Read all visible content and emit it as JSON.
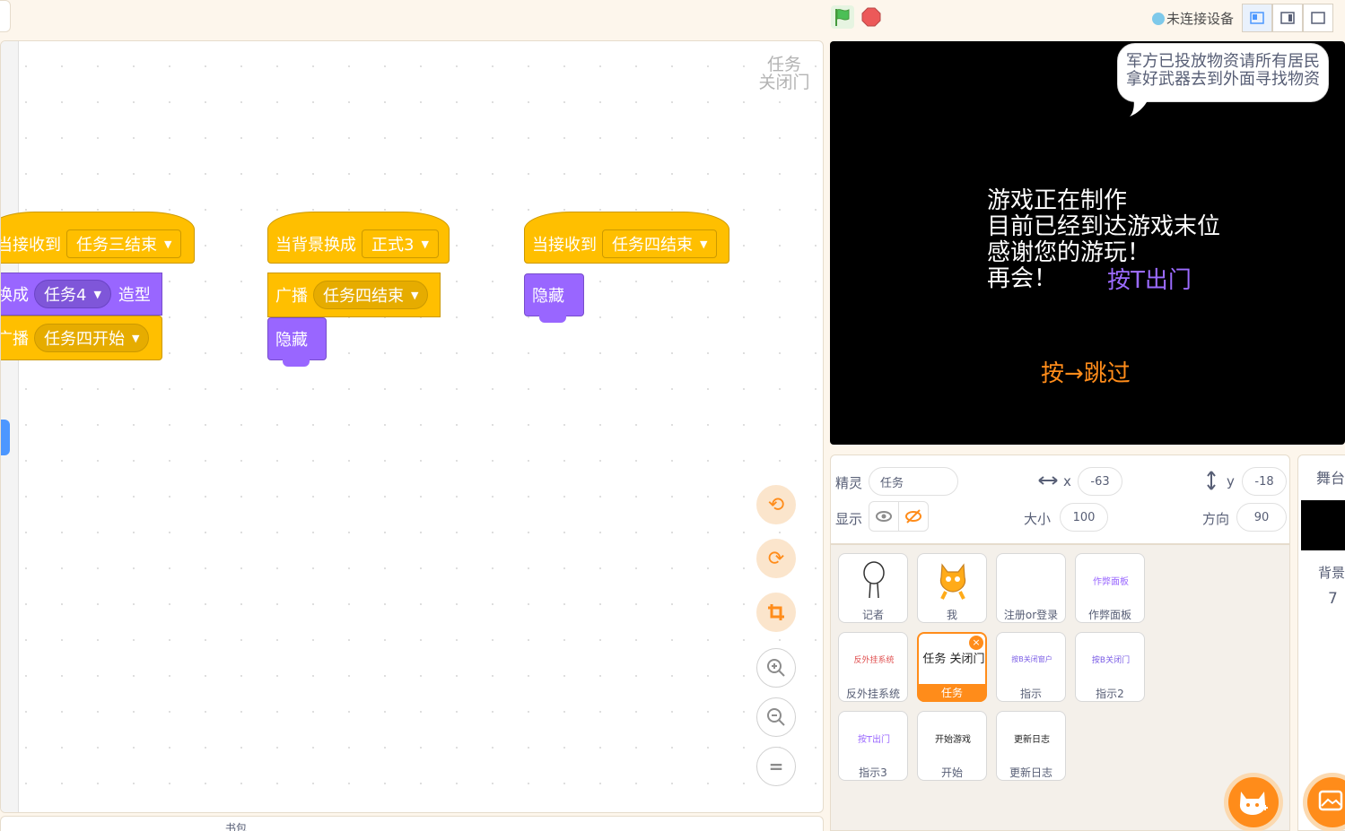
{
  "topbar": {
    "connection_status": "未连接设备",
    "layout_modes": [
      "small-stage",
      "normal-stage",
      "fullscreen"
    ]
  },
  "workspace": {
    "sprite_watermark_line1": "任务",
    "sprite_watermark_line2": "关闭门",
    "scripts": [
      {
        "hat_label": "当接收到",
        "hat_value": "任务三结束",
        "blocks": [
          {
            "label": "换成",
            "value": "任务4",
            "suffix": "造型"
          },
          {
            "label": "广播",
            "value": "任务四开始"
          }
        ]
      },
      {
        "hat_label": "当背景换成",
        "hat_value": "正式3",
        "blocks": [
          {
            "label": "广播",
            "value": "任务四结束"
          },
          {
            "label": "隐藏"
          }
        ]
      },
      {
        "hat_label": "当接收到",
        "hat_value": "任务四结束",
        "blocks": [
          {
            "label": "隐藏"
          }
        ]
      }
    ],
    "zoom_controls": [
      "undo-icon",
      "redo-icon",
      "crop-icon",
      "zoom-in-icon",
      "zoom-out-icon",
      "zoom-reset-icon"
    ],
    "backpack_label": "书包"
  },
  "stage": {
    "speech_line1": "军方已投放物资请所有居民",
    "speech_line2": "拿好武器去到外面寻找物资",
    "main_lines": [
      "游戏正在制作",
      "目前已经到达游戏末位",
      "感谢您的游玩！",
      "再会！"
    ],
    "exit_hint": "按T出门",
    "skip_hint": "按→跳过"
  },
  "sprite_info": {
    "sprite_label": "精灵",
    "sprite_name": "任务",
    "x_label": "x",
    "x_value": "-63",
    "y_label": "y",
    "y_value": "-18",
    "show_label": "显示",
    "size_label": "大小",
    "size_value": "100",
    "direction_label": "方向",
    "direction_value": "90"
  },
  "sprites": [
    {
      "name": "记者",
      "thumb": ""
    },
    {
      "name": "我",
      "thumb": ""
    },
    {
      "name": "注册or登录",
      "thumb": ""
    },
    {
      "name": "作弊面板",
      "thumb": "作弊面板"
    },
    {
      "name": "反外挂系统",
      "thumb": "反外挂系统"
    },
    {
      "name": "任务",
      "thumb": "任务 关闭门",
      "selected": true
    },
    {
      "name": "指示",
      "thumb": "按B关闭窗户"
    },
    {
      "name": "指示2",
      "thumb": "按B关闭门"
    },
    {
      "name": "指示3",
      "thumb": "按T出门"
    },
    {
      "name": "开始",
      "thumb": "开始游戏"
    },
    {
      "name": "更新日志",
      "thumb": "更新日志"
    }
  ],
  "stage_panel": {
    "title": "舞台",
    "backdrop_label": "背景",
    "backdrop_count": "7"
  },
  "colors": {
    "events": "#ffbf00",
    "looks": "#9966ff",
    "accent": "#ff8c1a"
  }
}
